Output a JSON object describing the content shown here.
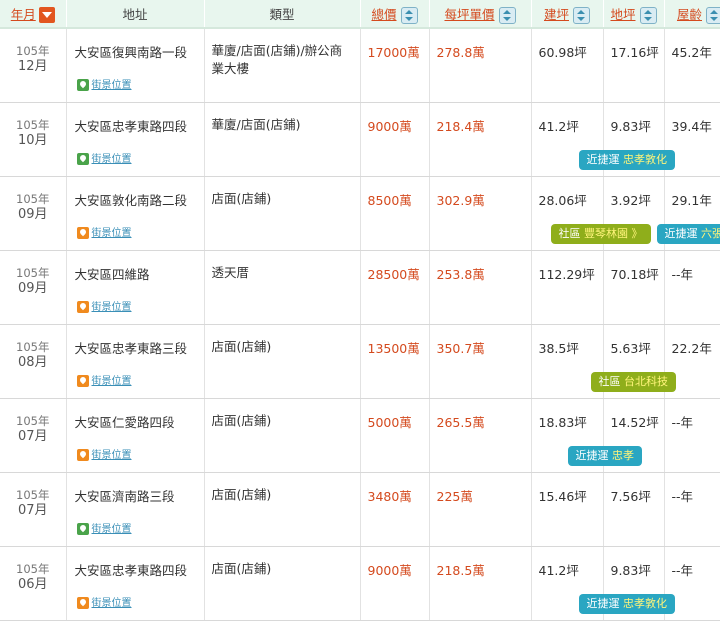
{
  "headers": {
    "date": "年月",
    "address": "地址",
    "type": "類型",
    "total": "總價",
    "unit_price": "每坪單價",
    "building_area": "建坪",
    "land_area": "地坪",
    "age": "屋齡"
  },
  "map_link_label": "街景位置",
  "rows": [
    {
      "year": "105年",
      "month": "12月",
      "address": "大安區復興南路一段",
      "type": "華廈/店面(店鋪)/辦公商業大樓",
      "total": "17000萬",
      "unit": "278.8萬",
      "area": "60.98坪",
      "land": "17.16坪",
      "age": "45.2年",
      "badges": []
    },
    {
      "year": "105年",
      "month": "10月",
      "address": "大安區忠孝東路四段",
      "type": "華廈/店面(店鋪)",
      "total": "9000萬",
      "unit": "218.4萬",
      "area": "41.2坪",
      "land": "9.83坪",
      "age": "39.4年",
      "badges": [
        {
          "label": "近捷運",
          "value": "忠孝敦化"
        }
      ]
    },
    {
      "year": "105年",
      "month": "09月",
      "address": "大安區敦化南路二段",
      "type": "店面(店鋪)",
      "total": "8500萬",
      "unit": "302.9萬",
      "area": "28.06坪",
      "land": "3.92坪",
      "age": "29.1年",
      "badges": [
        {
          "label": "社區",
          "value": "豐琴林園 》"
        },
        {
          "label": "近捷運",
          "value": "六張犁"
        }
      ]
    },
    {
      "year": "105年",
      "month": "09月",
      "address": "大安區四維路",
      "type": "透天厝",
      "total": "28500萬",
      "unit": "253.8萬",
      "area": "112.29坪",
      "land": "70.18坪",
      "age": "--年",
      "badges": []
    },
    {
      "year": "105年",
      "month": "08月",
      "address": "大安區忠孝東路三段",
      "type": "店面(店鋪)",
      "total": "13500萬",
      "unit": "350.7萬",
      "area": "38.5坪",
      "land": "5.63坪",
      "age": "22.2年",
      "badges": [
        {
          "label": "社區",
          "value": "台北科技"
        }
      ]
    },
    {
      "year": "105年",
      "month": "07月",
      "address": "大安區仁愛路四段",
      "type": "店面(店鋪)",
      "total": "5000萬",
      "unit": "265.5萬",
      "area": "18.83坪",
      "land": "14.52坪",
      "age": "--年",
      "badges": [
        {
          "label": "近捷運",
          "value": "忠孝"
        }
      ]
    },
    {
      "year": "105年",
      "month": "07月",
      "address": "大安區濟南路三段",
      "type": "店面(店鋪)",
      "total": "3480萬",
      "unit": "225萬",
      "area": "15.46坪",
      "land": "7.56坪",
      "age": "--年",
      "badges": []
    },
    {
      "year": "105年",
      "month": "06月",
      "address": "大安區忠孝東路四段",
      "type": "店面(店鋪)",
      "total": "9000萬",
      "unit": "218.5萬",
      "area": "41.2坪",
      "land": "9.83坪",
      "age": "--年",
      "badges": [
        {
          "label": "近捷運",
          "value": "忠孝敦化"
        }
      ]
    }
  ]
}
